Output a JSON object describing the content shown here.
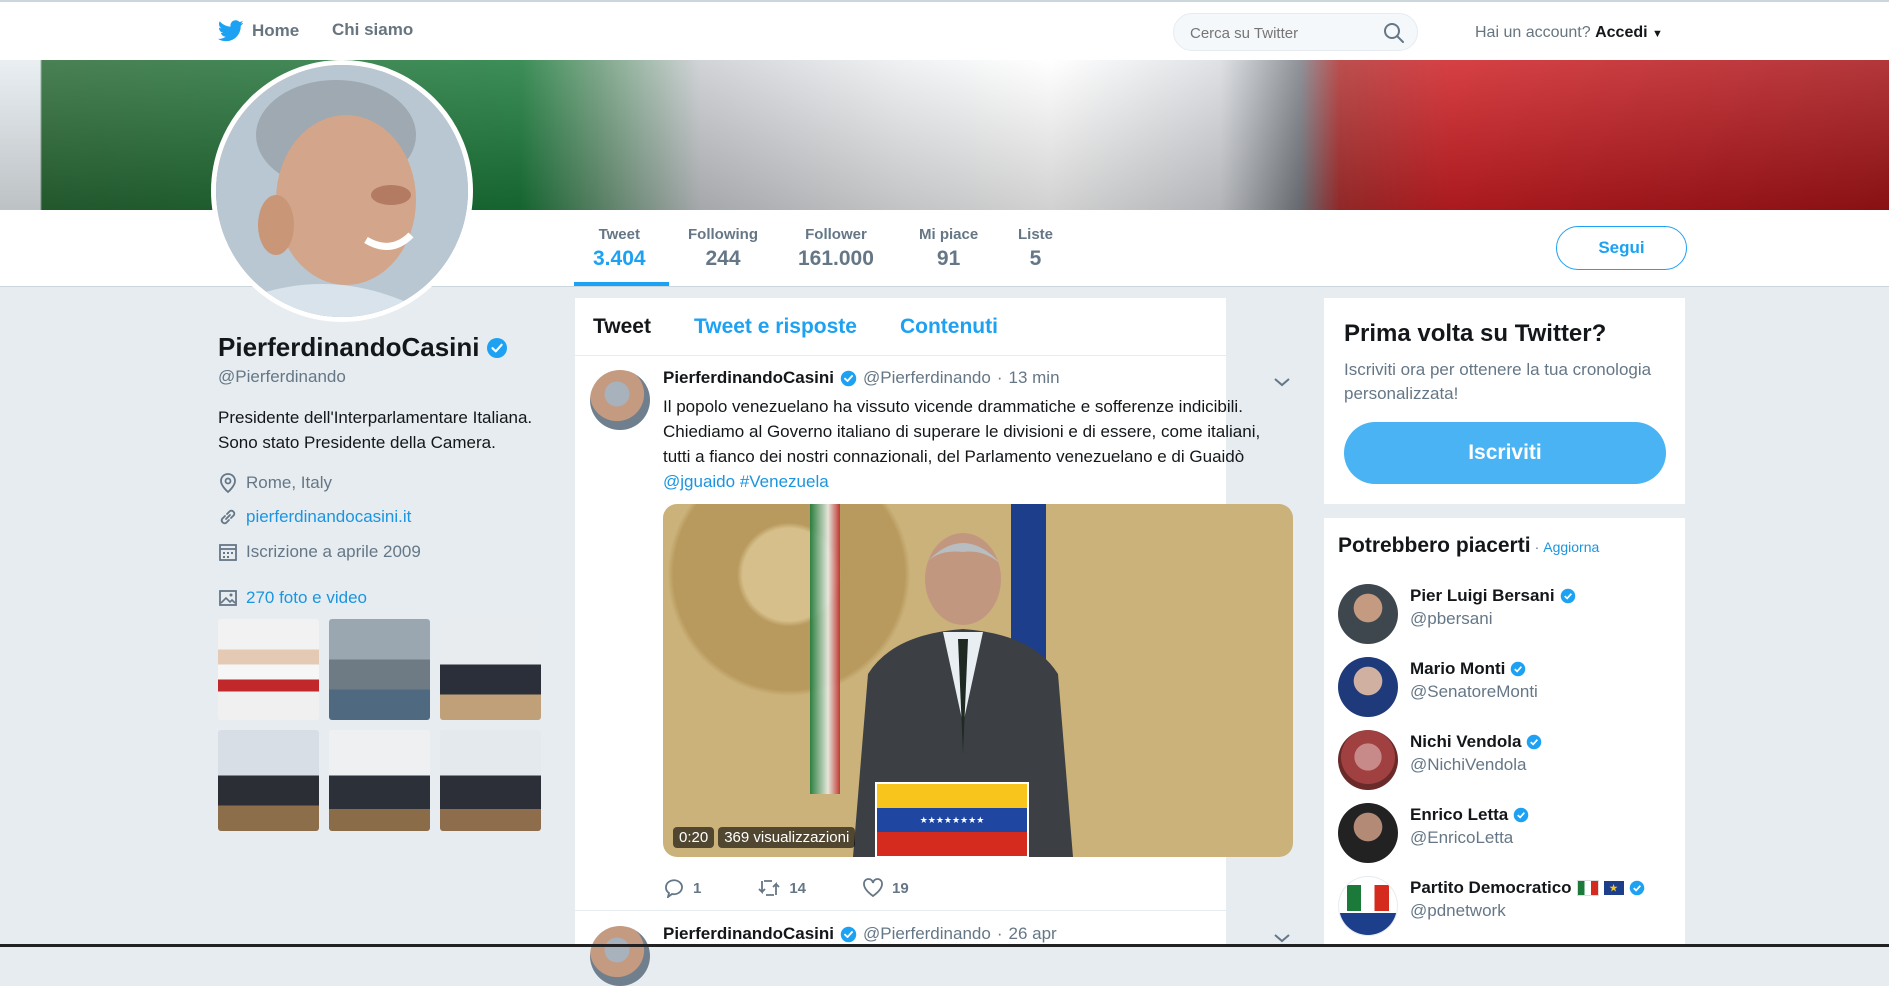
{
  "nav": {
    "home": "Home",
    "about": "Chi siamo"
  },
  "search": {
    "placeholder": "Cerca su Twitter"
  },
  "account": {
    "prompt": "Hai un account?",
    "login": "Accedi"
  },
  "stats": [
    {
      "label": "Tweet",
      "value": "3.404"
    },
    {
      "label": "Following",
      "value": "244"
    },
    {
      "label": "Follower",
      "value": "161.000"
    },
    {
      "label": "Mi piace",
      "value": "91"
    },
    {
      "label": "Liste",
      "value": "5"
    }
  ],
  "follow_button": "Segui",
  "profile": {
    "name": "PierferdinandoCasini",
    "handle": "@Pierferdinando",
    "bio_line1": "Presidente dell'Interparlamentare Italiana.",
    "bio_line2": "Sono stato Presidente della Camera.",
    "location": "Rome, Italy",
    "website": "pierferdinandocasini.it",
    "joined": "Iscrizione a aprile 2009",
    "media": "270 foto e video"
  },
  "timeline_tabs": [
    "Tweet",
    "Tweet e risposte",
    "Contenuti"
  ],
  "tweet1": {
    "name": "PierferdinandoCasini",
    "handle": "@Pierferdinando",
    "sep": "·",
    "time": "13 min",
    "text": "Il popolo venezuelano ha vissuto vicende drammatiche e sofferenze indicibili. Chiediamo al Governo italiano di superare le divisioni e di essere, come italiani, tutti a fianco dei nostri connazionali, del Parlamento venezuelano e di Guaidò",
    "mention": "@jguaido",
    "hashtag": "#Venezuela",
    "video_duration": "0:20",
    "video_views": "369 visualizzazioni",
    "replies": "1",
    "retweets": "14",
    "likes": "19"
  },
  "tweet2": {
    "name": "PierferdinandoCasini",
    "handle": "@Pierferdinando",
    "sep": "·",
    "time": "26 apr"
  },
  "signup": {
    "title": "Prima volta su Twitter?",
    "subtitle": "Iscriviti ora per ottenere la tua cronologia personalizzata!",
    "button": "Iscriviti"
  },
  "suggestions": {
    "title": "Potrebbero piacerti",
    "refresh": "Aggiorna",
    "sep": "·",
    "items": [
      {
        "name": "Pier Luigi Bersani",
        "handle": "@pbersani"
      },
      {
        "name": "Mario Monti",
        "handle": "@SenatoreMonti"
      },
      {
        "name": "Nichi Vendola",
        "handle": "@NichiVendola"
      },
      {
        "name": "Enrico Letta",
        "handle": "@EnricoLetta"
      },
      {
        "name": "Partito Democratico",
        "handle": "@pdnetwork"
      }
    ]
  },
  "colors": {
    "accent": "#1da1f2",
    "link": "#1b95e0",
    "muted": "#657786",
    "background": "#e6ecf0"
  }
}
